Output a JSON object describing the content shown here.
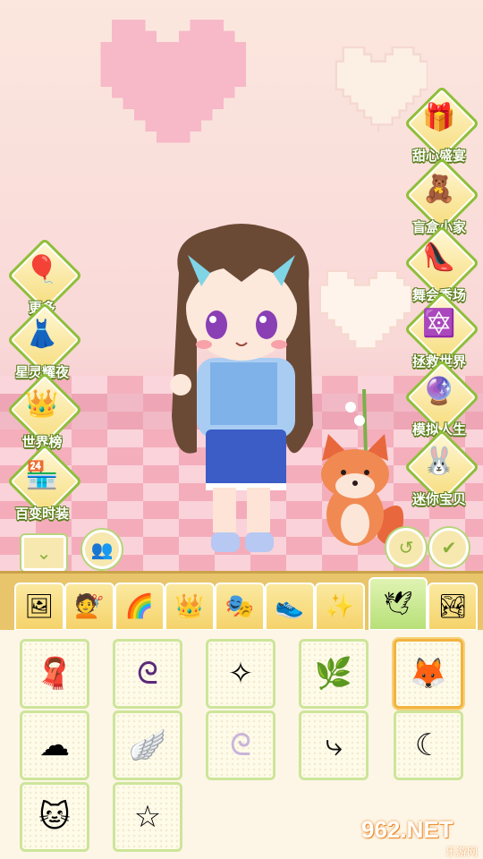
{
  "side_left": [
    {
      "label": "更多",
      "icon": "balloons-icon"
    },
    {
      "label": "星灵耀夜",
      "icon": "dress-icon"
    },
    {
      "label": "世界榜",
      "icon": "crown-icon"
    },
    {
      "label": "百变时装",
      "icon": "shop-icon"
    }
  ],
  "side_right": [
    {
      "label": "甜心盛宴",
      "icon": "gift-box-icon"
    },
    {
      "label": "盲盒小家",
      "icon": "blind-box-icon"
    },
    {
      "label": "舞会秀场",
      "icon": "high-heel-icon"
    },
    {
      "label": "拯救世界",
      "icon": "magic-circle-icon"
    },
    {
      "label": "模拟人生",
      "icon": "crystal-ball-icon"
    },
    {
      "label": "迷你宝贝",
      "icon": "bunny-cake-icon"
    }
  ],
  "tabs": [
    {
      "name": "tab-background",
      "icon": "frame-icon"
    },
    {
      "name": "tab-hair-back",
      "icon": "hair-icon"
    },
    {
      "name": "tab-hair-color",
      "icon": "hair-color-icon"
    },
    {
      "name": "tab-crown",
      "icon": "crown-icon"
    },
    {
      "name": "tab-mask",
      "icon": "mask-icon"
    },
    {
      "name": "tab-shoes",
      "icon": "shoe-icon"
    },
    {
      "name": "tab-wand",
      "icon": "wand-icon"
    },
    {
      "name": "tab-wings",
      "icon": "wings-icon",
      "active": true
    },
    {
      "name": "tab-scene",
      "icon": "picture-icon"
    }
  ],
  "items": [
    {
      "name": "item-scarf",
      "icon": "scarf-icon"
    },
    {
      "name": "item-purple-tail",
      "icon": "tail-icon"
    },
    {
      "name": "item-white-sparkles",
      "icon": "sparkle-icon"
    },
    {
      "name": "item-lily-vine",
      "icon": "vine-icon"
    },
    {
      "name": "item-fox-pet",
      "icon": "fox-icon",
      "selected": true
    },
    {
      "name": "item-clouds",
      "icon": "cloud-icon"
    },
    {
      "name": "item-white-wings",
      "icon": "wings-icon"
    },
    {
      "name": "item-white-tail",
      "icon": "tail-icon"
    },
    {
      "name": "item-black-tail",
      "icon": "tail-icon"
    },
    {
      "name": "item-black-scythe",
      "icon": "scythe-icon"
    },
    {
      "name": "item-cat-ring",
      "icon": "cat-ring-icon"
    },
    {
      "name": "item-sketch-stars",
      "icon": "sketch-icon"
    }
  ],
  "watermark": {
    "brand": "962.NET",
    "sub": "乐游网"
  },
  "colors": {
    "accent": "#8fbf3a",
    "gold": "#f5d36b",
    "pink": "#f4aab9"
  }
}
